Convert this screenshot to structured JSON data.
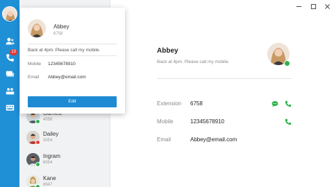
{
  "rail": {
    "badge_count": "13",
    "icons": [
      "user-avatar",
      "contacts-icon",
      "calls-icon",
      "chat-icon",
      "meeting-icon",
      "keypad-icon"
    ]
  },
  "card": {
    "name": "Abbey",
    "extension": "6758",
    "status": "Back at 4pm. Please call my mobile.",
    "mobile_label": "Mobile",
    "mobile_value": "12345678910",
    "email_label": "Email",
    "email_value": "Abbey@email.com",
    "edit_label": "Edit"
  },
  "contacts": [
    {
      "name": "Garnett",
      "ext": "4056",
      "presence": "#2eb24a"
    },
    {
      "name": "Dailey",
      "ext": "3054",
      "presence": "#e53935"
    },
    {
      "name": "Ingram",
      "ext": "6054",
      "presence": "#2eb24a"
    },
    {
      "name": "Kane",
      "ext": "8647",
      "presence": "#2eb24a"
    }
  ],
  "detail": {
    "name": "Abbey",
    "status": "Back at 4pm. Please call my mobile.",
    "rows": [
      {
        "label": "Extension",
        "value": "6758"
      },
      {
        "label": "Mobile",
        "value": "12345678910"
      },
      {
        "label": "Email",
        "value": "Abbey@email.com"
      }
    ]
  },
  "colors": {
    "accent": "#1e8ad3",
    "online": "#2eb24a",
    "busy": "#e53935"
  }
}
